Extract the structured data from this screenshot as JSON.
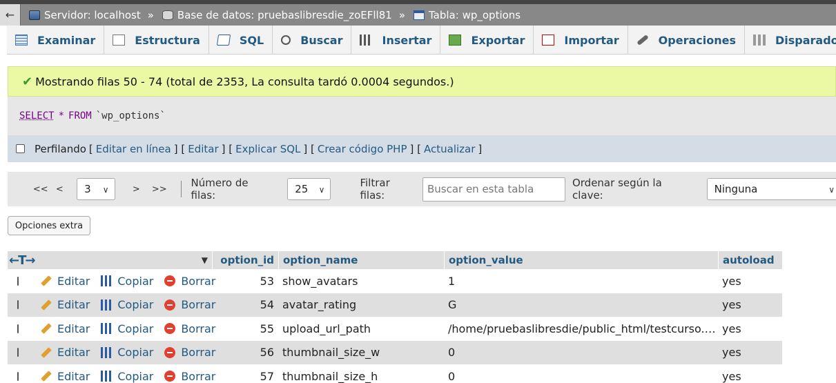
{
  "breadcrumb": {
    "back": "←",
    "server": "Servidor: localhost",
    "database": "Base de datos: pruebaslibresdie_zoEFll81",
    "table": "Tabla: wp_options",
    "separator": "»"
  },
  "tabs": [
    {
      "label": "Examinar",
      "icon": "browse-icon"
    },
    {
      "label": "Estructura",
      "icon": "structure-icon"
    },
    {
      "label": "SQL",
      "icon": "sql-icon"
    },
    {
      "label": "Buscar",
      "icon": "search-icon"
    },
    {
      "label": "Insertar",
      "icon": "insert-icon"
    },
    {
      "label": "Exportar",
      "icon": "export-icon"
    },
    {
      "label": "Importar",
      "icon": "import-icon"
    },
    {
      "label": "Operaciones",
      "icon": "wrench-icon"
    },
    {
      "label": "Disparadores",
      "icon": "triggers-icon"
    }
  ],
  "notice": {
    "check": "✔",
    "text": "Mostrando filas 50 - 74 (total de 2353, La consulta tardó 0.0004 segundos.)"
  },
  "sql": {
    "select": "SELECT",
    "star": "*",
    "from": "FROM",
    "table": "`wp_options`"
  },
  "profiling": {
    "label": "Perfilando",
    "links": [
      "Editar en línea",
      "Editar",
      "Explicar SQL",
      "Crear código PHP",
      "Actualizar"
    ]
  },
  "nav": {
    "first": "<<",
    "prev": "<",
    "page": "3",
    "next": ">",
    "last": ">>",
    "rows_label": "Número de filas:",
    "rows_value": "25",
    "filter_label": "Filtrar filas:",
    "filter_placeholder": "Buscar en esta tabla",
    "sort_label": "Ordenar según la clave:",
    "sort_value": "Ninguna"
  },
  "extra_options": "Opciones extra",
  "table": {
    "arrows": "←T→",
    "columns": [
      "option_id",
      "option_name",
      "option_value",
      "autoload"
    ],
    "actions": {
      "edit": "Editar",
      "copy": "Copiar",
      "delete": "Borrar"
    },
    "rows": [
      {
        "id": "53",
        "name": "show_avatars",
        "value": "1",
        "autoload": "yes"
      },
      {
        "id": "54",
        "name": "avatar_rating",
        "value": "G",
        "autoload": "yes"
      },
      {
        "id": "55",
        "name": "upload_url_path",
        "value": "/home/pruebaslibresdie/public_html/testcurso.super...",
        "autoload": "yes"
      },
      {
        "id": "56",
        "name": "thumbnail_size_w",
        "value": "0",
        "autoload": "yes"
      },
      {
        "id": "57",
        "name": "thumbnail_size_h",
        "value": "0",
        "autoload": "yes"
      }
    ]
  }
}
